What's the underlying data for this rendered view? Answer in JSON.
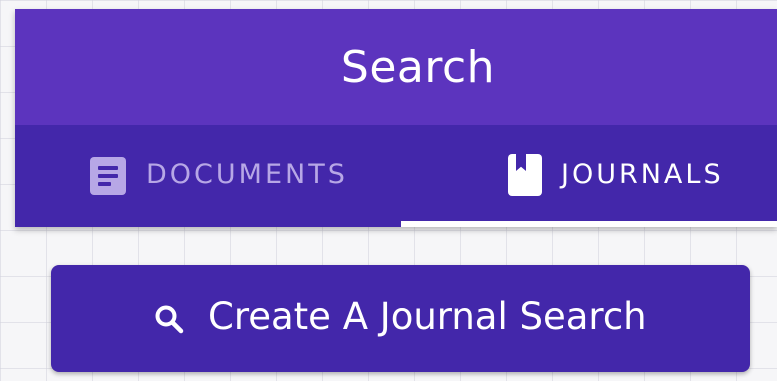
{
  "header": {
    "title": "Search"
  },
  "tabs": [
    {
      "label": "DOCUMENTS",
      "icon": "document-icon",
      "selected": false
    },
    {
      "label": "JOURNALS",
      "icon": "book-icon",
      "selected": true
    }
  ],
  "create_button": {
    "label": "Create A Journal Search",
    "icon": "search-icon"
  },
  "colors": {
    "app_bar": "#5c34be",
    "tab_bar": "#4327aa",
    "button": "#4327aa",
    "inactive_tab": "#b7a7e6",
    "active_tab": "#ffffff"
  }
}
